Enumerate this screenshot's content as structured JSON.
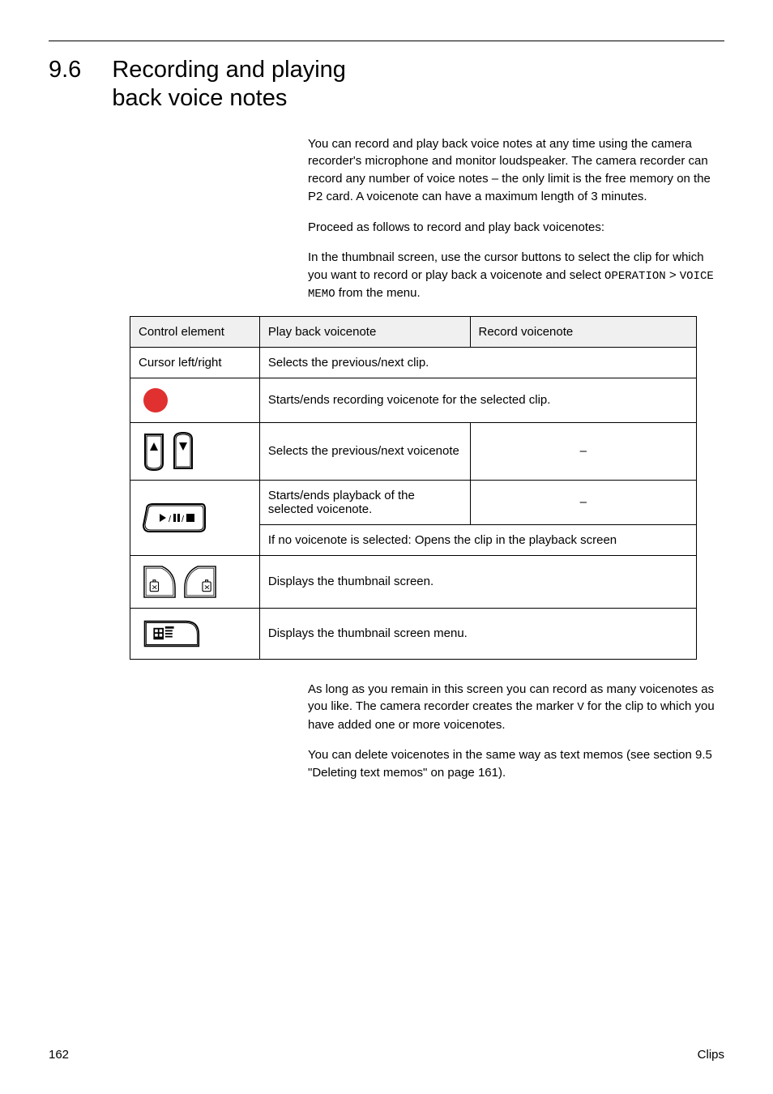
{
  "header": {
    "section_number": "9.6",
    "section_title_l1": "Recording and playing",
    "section_title_l2": "back voice notes"
  },
  "intro": {
    "p1_pre": "You can record and play back voice notes at any time using the camera recorder's microphone and monitor loudspeaker. The camera recorder can record any number of voice notes – the only limit is the free memory on the P2 card. A voicenote can have a maximum length of ",
    "p1_len": "3 minutes",
    "p1_post": ".",
    "p2": "Proceed as follows to record and play back voicenotes:",
    "p3_pre": "In the thumbnail screen, use the cursor buttons to select the clip for which you want to record or play back a voicenote and select ",
    "p3_sys1": "OPERATION",
    "p3_mid": " > ",
    "p3_sys2": "VOICE MEMO",
    "p3_post": " from the menu."
  },
  "table": {
    "h_control": "Control element",
    "h_play": "Play back voicenote",
    "h_rec": "Record voicenote",
    "r_cursor_lr": "Cursor left/right",
    "r_cursor_lr_desc": "Selects the previous/next clip.",
    "r_rec_desc": "Starts/ends recording voicenote for the selected clip.",
    "r_cursor_ud_play": "Selects the previous/next voicenote",
    "r_cursor_ud_rec": "–",
    "r_playpause_play": "Starts/ends playback of the selected voicenote.",
    "r_playpause_rec": "–",
    "r_playpause_rec2": "If no voicenote is selected: Opens the clip in the playback screen",
    "r_thumb_desc": "Displays the thumbnail screen.",
    "r_menu_desc": "Displays the thumbnail screen menu."
  },
  "after": {
    "p4_pre": "As long as you remain in this screen you can record as many voicenotes as you like. The camera recorder creates the marker ",
    "p4_marker": "V",
    "p4_post": " for the clip to which you have added one or more voicenotes.",
    "p5_pre": "You can delete voicenotes in the same way as text memos (see section 9.5 \"Deleting text memos\" on page ",
    "p5_page": "161",
    "p5_post": ")."
  },
  "footer": {
    "left": "162",
    "right": "Clips"
  }
}
